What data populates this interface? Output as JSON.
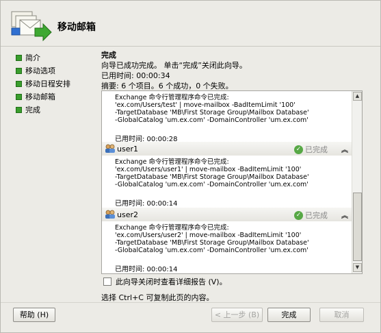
{
  "header": {
    "title": "移动邮箱"
  },
  "nav": {
    "items": [
      {
        "label": "简介"
      },
      {
        "label": "移动选项"
      },
      {
        "label": "移动日程安排"
      },
      {
        "label": "移动邮箱"
      },
      {
        "label": "完成"
      }
    ]
  },
  "content": {
    "title": "完成",
    "message": "向导已成功完成。 单击“完成”关闭此向导。",
    "elapsed": "已用时间: 00:00:34",
    "summary": "摘要: 6 个项目。6 个成功，0 个失败。"
  },
  "results": {
    "top_block": {
      "lines": [
        "Exchange 命令行管理程序命令已完成:",
        "'ex.com/Users/test' | move-mailbox -BadItemLimit '100'",
        "-TargetDatabase 'MB\\First Storage Group\\Mailbox Database'",
        "-GlobalCatalog 'um.ex.com' -DomainController 'um.ex.com'"
      ],
      "elapsed": "已用时间: 00:00:28"
    },
    "blocks": [
      {
        "name": "user1",
        "status": "已完成",
        "lines": [
          "Exchange 命令行管理程序命令已完成:",
          "'ex.com/Users/user1' | move-mailbox -BadItemLimit '100'",
          "-TargetDatabase 'MB\\First Storage Group\\Mailbox Database'",
          "-GlobalCatalog 'um.ex.com' -DomainController 'um.ex.com'"
        ],
        "elapsed": "已用时间: 00:00:14"
      },
      {
        "name": "user2",
        "status": "已完成",
        "lines": [
          "Exchange 命令行管理程序命令已完成:",
          "'ex.com/Users/user2' | move-mailbox -BadItemLimit '100'",
          "-TargetDatabase 'MB\\First Storage Group\\Mailbox Database'",
          "-GlobalCatalog 'um.ex.com' -DomainController 'um.ex.com'"
        ],
        "elapsed": "已用时间: 00:00:14"
      }
    ]
  },
  "checkbox_label": "此向导关闭时查看详细报告 (V)。",
  "tip": "选择 Ctrl+C 可复制此页的内容。",
  "buttons": {
    "help": "帮助 (H)",
    "back": "< 上一步 (B)",
    "finish": "完成",
    "cancel": "取消"
  }
}
